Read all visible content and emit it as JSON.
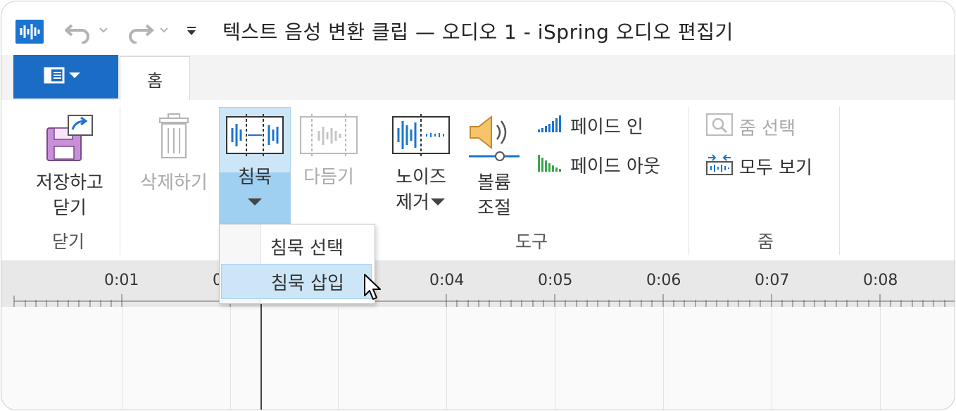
{
  "window": {
    "title": "텍스트 음성 변환 클립 — 오디오  1 - iSpring 오디오 편집기"
  },
  "qat": {
    "undo_icon": "undo-icon",
    "redo_icon": "redo-icon",
    "customize_icon": "customize-qat-icon"
  },
  "tabs": {
    "file_icon": "file-menu-icon",
    "home": "홈"
  },
  "ribbon": {
    "save_close": "저장하고\n닫기",
    "save_close_line1": "저장하고",
    "save_close_line2": "닫기",
    "group_close": "닫기",
    "delete": "삭제하기",
    "silence": "침묵",
    "trim": "다듬기",
    "noise_line1": "노이즈",
    "noise_line2": "제거",
    "volume_line1": "볼륨",
    "volume_line2": "조절",
    "fade_in": "페이드 인",
    "fade_out": "페이드 아웃",
    "group_tools": "도구",
    "zoom_select": "줌 선택",
    "view_all": "모두 보기",
    "group_zoom": "줌"
  },
  "silence_menu": {
    "items": [
      "침묵 선택",
      "침묵 삽입"
    ],
    "highlighted": "침묵 삽입"
  },
  "timeline": {
    "ticks": [
      "0:01",
      "0",
      "0:04",
      "0:05",
      "0:06",
      "0:07",
      "0:08"
    ]
  },
  "colors": {
    "accent": "#1b6cc4",
    "hover": "#cce6f8"
  }
}
